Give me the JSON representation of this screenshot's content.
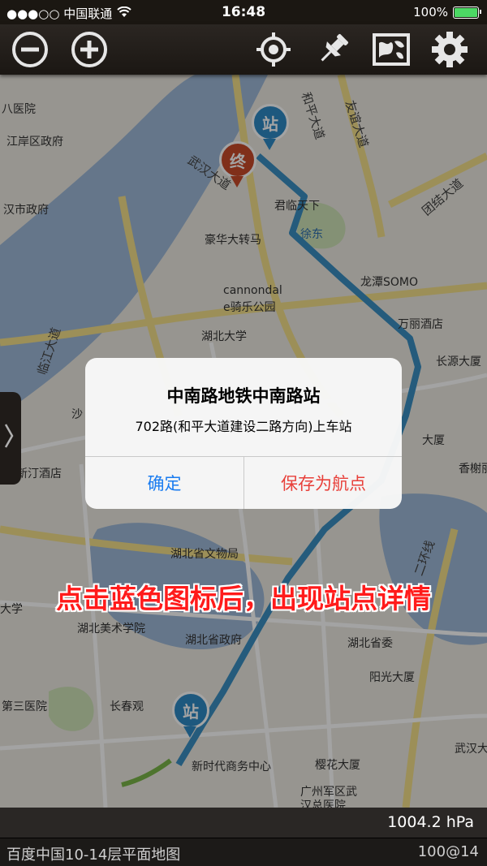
{
  "status_bar": {
    "carrier": "●●●○○ 中国联通",
    "time": "16:48",
    "battery_percent": "100%",
    "battery_level": 1.0,
    "battery_color": "#4cd964"
  },
  "toolbar": {
    "zoom_out_icon": "minus-circle-icon",
    "zoom_in_icon": "plus-circle-icon",
    "locate_icon": "crosshair-icon",
    "pin_icon": "pushpin-icon",
    "map_layers_icon": "map-icon",
    "settings_icon": "gear-icon"
  },
  "map": {
    "labels": {
      "l1": "八医院",
      "l2": "江岸区政府",
      "l3": "汉市政府",
      "l4": "豪华大转马",
      "l5": "cannondal",
      "l6": "e骑乐公园",
      "l7": "湖北大学",
      "l8": "徐东",
      "l9": "龙潭SOMO",
      "l10": "万丽酒店",
      "l11": "长源大厦",
      "l12": "新汀酒店",
      "l13": "湖北省文物局",
      "l14": "湖北美术学院",
      "l15": "湖北省政府",
      "l16": "湖北省委",
      "l17": "阳光大厦",
      "l18": "第三医院",
      "l19": "长春观",
      "l20": "新时代商务中心",
      "l21": "樱花大厦",
      "l22": "广州军区武",
      "l23": "汉总医院",
      "l24": "武汉大",
      "l25": "香榭丽",
      "l26": "君临天下",
      "l27": "和平大道",
      "l28": "友谊大道",
      "l29": "团结大道",
      "l30": "武汉大道",
      "l31": "大厦",
      "l32": "大学",
      "l33": "二环线",
      "l34": "临江大道",
      "l35": "沙"
    },
    "marker_end": "终",
    "marker_station_top": "站",
    "marker_station_bottom": "站",
    "route_color": "#3a8fc2",
    "side_tab_icon": "chevron-right-icon"
  },
  "annotation": "点击蓝色图标后，出现站点详情",
  "alert": {
    "title": "中南路地铁中南路站",
    "message": "702路(和平大道建设二路方向)上车站",
    "confirm_label": "确定",
    "save_label": "保存为航点"
  },
  "pressure": "1004.2 hPa",
  "bottom_bar": {
    "map_name": "百度中国10-14层平面地图",
    "zoom_info": "100@14"
  }
}
